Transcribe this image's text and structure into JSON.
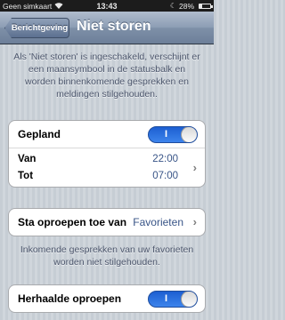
{
  "status_bar": {
    "carrier": "Geen simkaart",
    "time": "13:43",
    "battery_percent": "28%",
    "battery_level": 0.28,
    "icons": [
      "wifi-icon",
      "moon-icon",
      "battery-icon"
    ]
  },
  "nav": {
    "back_label": "Berichtgeving",
    "title": "Niet storen"
  },
  "intro_text": "Als 'Niet storen' is ingeschakeld, verschijnt er een maansymbool in de statusbalk en worden binnenkomende gesprekken en meldingen stilgehouden.",
  "scheduled": {
    "label": "Gepland",
    "toggle_on_mark": "I",
    "toggle_state": "on",
    "from_label": "Van",
    "from_value": "22:00",
    "to_label": "Tot",
    "to_value": "07:00"
  },
  "allow_calls": {
    "label": "Sta oproepen toe van",
    "value": "Favorieten"
  },
  "allow_calls_note": "Inkomende gesprekken van uw favorieten worden niet stilgehouden.",
  "repeated_calls": {
    "label": "Herhaalde oproepen",
    "toggle_on_mark": "I",
    "toggle_state": "on"
  },
  "colors": {
    "accent_blue": "#2f73e0",
    "value_blue": "#385487",
    "nav_bar": "#8c9db4"
  }
}
